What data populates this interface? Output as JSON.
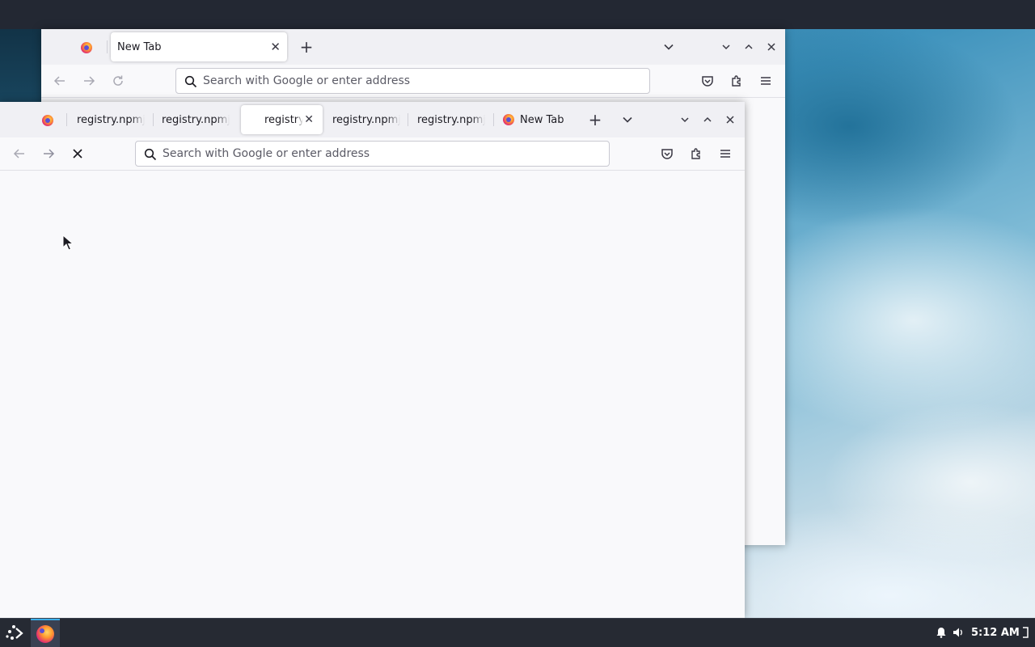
{
  "desktop": {
    "clock": "5:12 AM"
  },
  "back_window": {
    "tabs": [
      {
        "label": "New Tab",
        "icon": "firefox-icon",
        "selected": true
      }
    ],
    "url_placeholder": "Search with Google or enter address"
  },
  "front_window": {
    "tabs": [
      {
        "label": "registry.npmj",
        "selected": false
      },
      {
        "label": "registry.npmj",
        "selected": false
      },
      {
        "label": "registry",
        "selected": true
      },
      {
        "label": "registry.npmj",
        "selected": false
      },
      {
        "label": "registry.npmj",
        "selected": false
      },
      {
        "label": "New Tab",
        "icon": "firefox-icon",
        "selected": false
      }
    ],
    "url_placeholder": "Search with Google or enter address",
    "loading": true
  },
  "taskbar": {
    "items": [
      "app-launcher-icon",
      "firefox-icon"
    ],
    "tray": [
      "bell-icon",
      "volume-icon",
      "show-desktop-icon"
    ]
  }
}
